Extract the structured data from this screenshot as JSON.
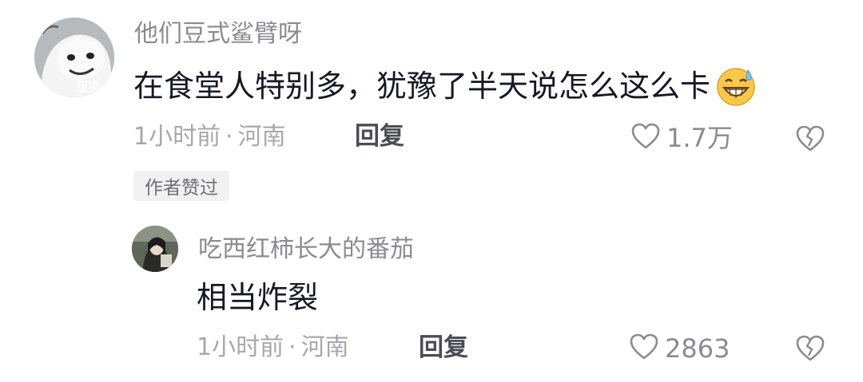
{
  "comment": {
    "username": "他们豆式鲨臂呀",
    "avatar_text": "想笑",
    "text": "在食堂人特别多，犹豫了半天说怎么这么卡",
    "emoji": "grinning-sweat-emoji",
    "time": "1小时前",
    "separator": "·",
    "location": "河南",
    "reply_label": "回复",
    "like_count": "1.7万",
    "author_liked_badge": "作者赞过"
  },
  "reply": {
    "username": "吃西红柿长大的番茄",
    "text": "相当炸裂",
    "time": "1小时前",
    "separator": "·",
    "location": "河南",
    "reply_label": "回复",
    "like_count": "2863"
  },
  "icons": {
    "like": "heart-outline-icon",
    "dislike": "broken-heart-icon"
  },
  "colors": {
    "primary_text": "#161823",
    "secondary_text": "#8a8b91",
    "muted_text": "#a7a8ad",
    "badge_bg": "#f1f1f2"
  }
}
